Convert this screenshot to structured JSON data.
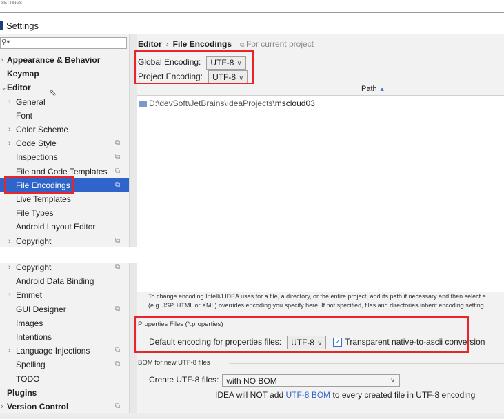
{
  "window": {
    "top_caption": "SETTINGS",
    "title": "Settings"
  },
  "sidebar": {
    "items_top": [
      {
        "label": "Appearance & Behavior",
        "arrow": "›",
        "bold": true
      },
      {
        "label": "Keymap",
        "arrow": "",
        "bold": true
      },
      {
        "label": "Editor",
        "arrow": "⌄",
        "bold": true
      },
      {
        "label": "General",
        "arrow": "›",
        "bold": false
      },
      {
        "label": "Font",
        "arrow": "",
        "bold": false
      },
      {
        "label": "Color Scheme",
        "arrow": "›",
        "bold": false
      },
      {
        "label": "Code Style",
        "arrow": "›",
        "bold": false
      },
      {
        "label": "Inspections",
        "arrow": "",
        "bold": false
      },
      {
        "label": "File and Code Templates",
        "arrow": "",
        "bold": false
      },
      {
        "label": "File Encodings",
        "arrow": "",
        "bold": false,
        "selected": true
      },
      {
        "label": "Live Templates",
        "arrow": "",
        "bold": false
      },
      {
        "label": "File Types",
        "arrow": "",
        "bold": false
      },
      {
        "label": "Android Layout Editor",
        "arrow": "",
        "bold": false
      },
      {
        "label": "Copyright",
        "arrow": "›",
        "bold": false
      }
    ],
    "items_bottom": [
      {
        "label": "Copyright",
        "arrow": "›",
        "bold": false
      },
      {
        "label": "Android Data Binding",
        "arrow": "",
        "bold": false
      },
      {
        "label": "Emmet",
        "arrow": "›",
        "bold": false
      },
      {
        "label": "GUI Designer",
        "arrow": "",
        "bold": false
      },
      {
        "label": "Images",
        "arrow": "",
        "bold": false
      },
      {
        "label": "Intentions",
        "arrow": "",
        "bold": false
      },
      {
        "label": "Language Injections",
        "arrow": "›",
        "bold": false
      },
      {
        "label": "Spelling",
        "arrow": "",
        "bold": false
      },
      {
        "label": "TODO",
        "arrow": "",
        "bold": false
      },
      {
        "label": "Plugins",
        "arrow": "",
        "bold": true
      },
      {
        "label": "Version Control",
        "arrow": "›",
        "bold": true
      }
    ]
  },
  "content": {
    "breadcrumb": {
      "parent": "Editor",
      "separator": "›",
      "current": "File Encodings",
      "scope": "For current project"
    },
    "global_encoding": {
      "label": "Global Encoding:",
      "value": "UTF-8"
    },
    "project_encoding": {
      "label": "Project Encoding:",
      "value": "UTF-8"
    },
    "table": {
      "header": "Path",
      "sort_glyph": "▲",
      "row_prefix": "D:\\devSoft\\JetBrains\\IdeaProjects\\",
      "row_name": "mscloud03"
    },
    "help_line1": "To change encoding IntelliJ IDEA uses for a file, a directory, or the entire project, add its path if necessary and then select e",
    "help_line2": "(e.g. JSP, HTML or XML) overrides encoding you specify here. If not specified, files and directories inherit encoding setting",
    "properties": {
      "group": "Properties Files (*.properties)",
      "label": "Default encoding for properties files:",
      "value": "UTF-8",
      "checkbox_label": "Transparent native-to-ascii conversion",
      "checked": "✓"
    },
    "bom": {
      "group": "BOM for new UTF-8 files",
      "label": "Create UTF-8 files:",
      "value": "with NO BOM",
      "note_before": "IDEA will NOT add ",
      "note_link": "UTF-8 BOM",
      "note_after": " to every created file in UTF-8 encoding"
    }
  }
}
